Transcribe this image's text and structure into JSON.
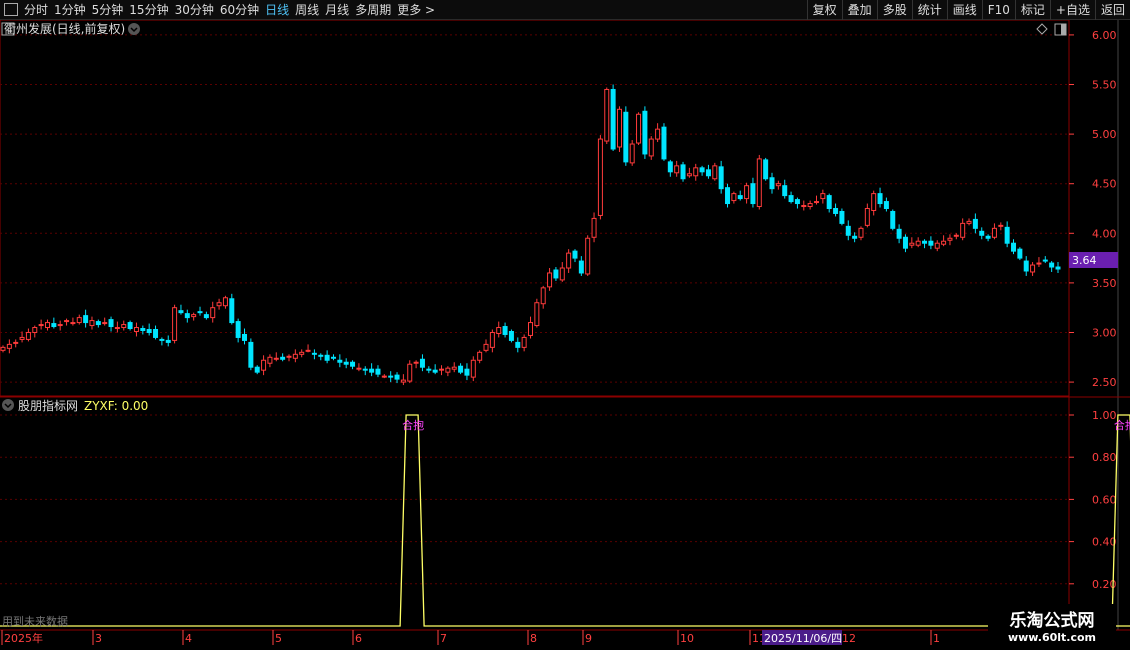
{
  "toolbar": {
    "timeframes": [
      "分时",
      "1分钟",
      "5分钟",
      "15分钟",
      "30分钟",
      "60分钟",
      "日线",
      "周线",
      "月线",
      "多周期",
      "更多 >"
    ],
    "active": "日线",
    "right_buttons": [
      "复权",
      "叠加",
      "多股",
      "统计",
      "画线",
      "F10",
      "标记",
      "+自选",
      "返回"
    ]
  },
  "main_panel": {
    "title": "衢州发展(日线,前复权)",
    "price_ticks": [
      "6.00",
      "5.50",
      "5.00",
      "4.50",
      "4.00",
      "3.50",
      "3.00",
      "2.50"
    ],
    "current_price": "3.64",
    "current_price_color": "#6a1fb0"
  },
  "indicator_panel": {
    "title": "股朋指标网",
    "value_label": "ZYXF: 0.00",
    "ticks": [
      "1.00",
      "0.80",
      "0.60",
      "0.40",
      "0.20"
    ],
    "signal_label": "合抱",
    "footer_note": "用到未来数据"
  },
  "x_axis": {
    "labels": [
      "2025年",
      "3",
      "4",
      "5",
      "6",
      "7",
      "8",
      "9",
      "10",
      "11",
      "12",
      "1"
    ],
    "cursor_date": "2025/11/06/四"
  },
  "watermark": {
    "line1": "乐淘公式网",
    "line2": "www.60lt.com"
  },
  "colors": {
    "up": "#ff3b3b",
    "down": "#00e5ff",
    "indicator_line": "#ffff66",
    "signal_text": "#ff44ff",
    "axis": "#ff4040"
  },
  "chart_data": {
    "type": "candlestick",
    "price_range": [
      2.4,
      6.1
    ],
    "closes": [
      2.85,
      2.88,
      2.9,
      2.95,
      3.0,
      3.05,
      3.08,
      3.1,
      3.06,
      3.08,
      3.12,
      3.1,
      3.15,
      3.1,
      3.12,
      3.08,
      3.1,
      3.06,
      3.05,
      3.08,
      3.04,
      3.05,
      3.02,
      3.0,
      2.95,
      2.92,
      2.9,
      3.25,
      3.2,
      3.15,
      3.18,
      3.2,
      3.15,
      3.25,
      3.3,
      3.35,
      3.1,
      2.95,
      2.92,
      2.65,
      2.6,
      2.72,
      2.75,
      2.74,
      2.73,
      2.76,
      2.78,
      2.8,
      2.82,
      2.78,
      2.76,
      2.72,
      2.74,
      2.7,
      2.68,
      2.66,
      2.64,
      2.62,
      2.6,
      2.58,
      2.56,
      2.55,
      2.53,
      2.52,
      2.68,
      2.7,
      2.65,
      2.62,
      2.6,
      2.63,
      2.64,
      2.65,
      2.6,
      2.57,
      2.72,
      2.8,
      2.88,
      3.0,
      3.05,
      2.98,
      2.92,
      2.85,
      2.95,
      3.1,
      3.3,
      3.45,
      3.6,
      3.55,
      3.65,
      3.8,
      3.75,
      3.6,
      3.95,
      4.15,
      4.95,
      5.45,
      4.85,
      5.25,
      4.72,
      4.9,
      5.2,
      4.8,
      4.95,
      5.05,
      4.75,
      4.62,
      4.68,
      4.55,
      4.6,
      4.66,
      4.62,
      4.58,
      4.68,
      4.45,
      4.3,
      4.4,
      4.35,
      4.48,
      4.3,
      4.75,
      4.55,
      4.45,
      4.5,
      4.38,
      4.32,
      4.3,
      4.28,
      4.3,
      4.32,
      4.4,
      4.25,
      4.2,
      4.1,
      3.98,
      3.95,
      4.05,
      4.25,
      4.4,
      4.3,
      4.25,
      4.05,
      3.95,
      3.85,
      3.9,
      3.92,
      3.9,
      3.88,
      3.9,
      3.92,
      3.95,
      3.98,
      4.1,
      4.12,
      4.05,
      3.98,
      3.95,
      4.05,
      4.08,
      3.9,
      3.82,
      3.75,
      3.62,
      3.68,
      3.7,
      3.72,
      3.66,
      3.64
    ],
    "indicator": {
      "name": "ZYXF",
      "signal_indices": [
        65,
        177
      ],
      "values_range": [
        0,
        1
      ]
    }
  }
}
